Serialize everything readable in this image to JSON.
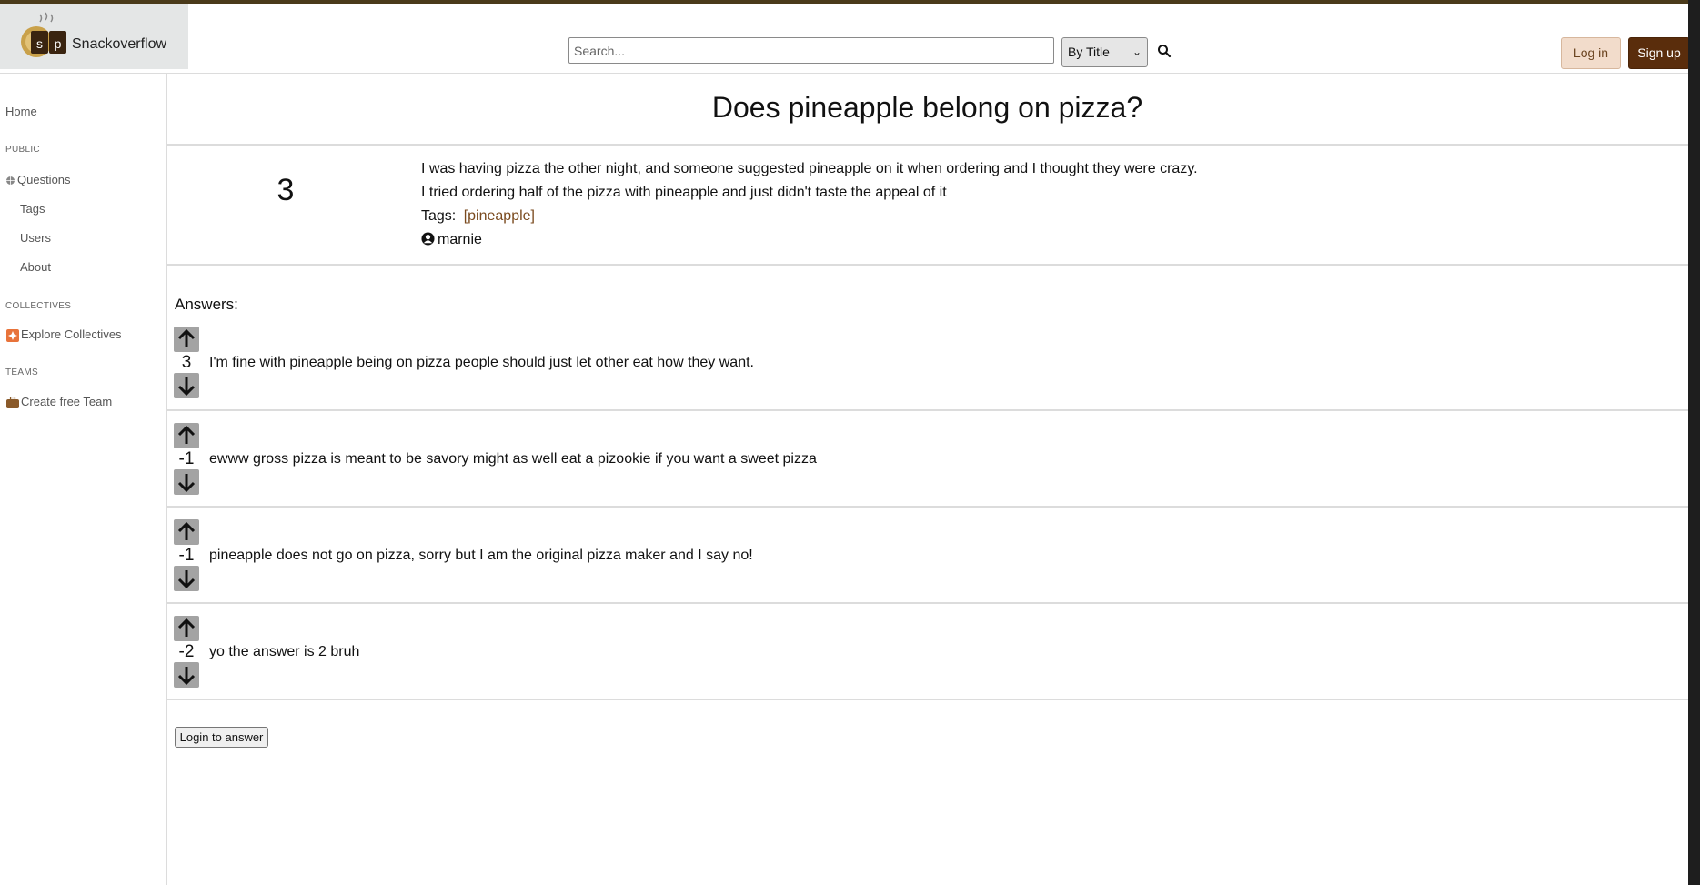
{
  "header": {
    "logo_text": "Snackoverflow",
    "logo_letters": [
      "s",
      "p"
    ],
    "search_placeholder": "Search...",
    "search_mode": "By Title",
    "login_label": "Log in",
    "signup_label": "Sign up"
  },
  "sidebar": {
    "home": "Home",
    "public_heading": "PUBLIC",
    "questions": "Questions",
    "tags": "Tags",
    "users": "Users",
    "about": "About",
    "collectives_heading": "COLLECTIVES",
    "explore_collectives": "Explore Collectives",
    "teams_heading": "TEAMS",
    "create_team": "Create free Team"
  },
  "question": {
    "title": "Does pineapple belong on pizza?",
    "votes": "3",
    "body_line1": "I was having pizza the other night, and someone suggested pineapple on it when ordering and I thought they were crazy.",
    "body_line2": "I tried ordering half of the pizza with pineapple and just didn't taste the appeal of it",
    "tags_label": "Tags:",
    "tag": "[pineapple]",
    "author": "marnie"
  },
  "answers_label": "Answers:",
  "answers": [
    {
      "votes": "3",
      "text": "I'm fine with pineapple being on pizza people should just let other eat how they want."
    },
    {
      "votes": "-1",
      "text": "ewww gross pizza is meant to be savory might as well eat a pizookie if you want a sweet pizza"
    },
    {
      "votes": "-1",
      "text": "pineapple does not go on pizza, sorry but I am the original pizza maker and I say no!"
    },
    {
      "votes": "-2",
      "text": "yo the answer is 2 bruh"
    }
  ],
  "login_to_answer": "Login to answer",
  "colors": {
    "brand_dark": "#5a2d0c",
    "login_bg": "#f2dccb",
    "tag_link": "#7a4a1e",
    "vote_button": "#a3a3a3"
  }
}
